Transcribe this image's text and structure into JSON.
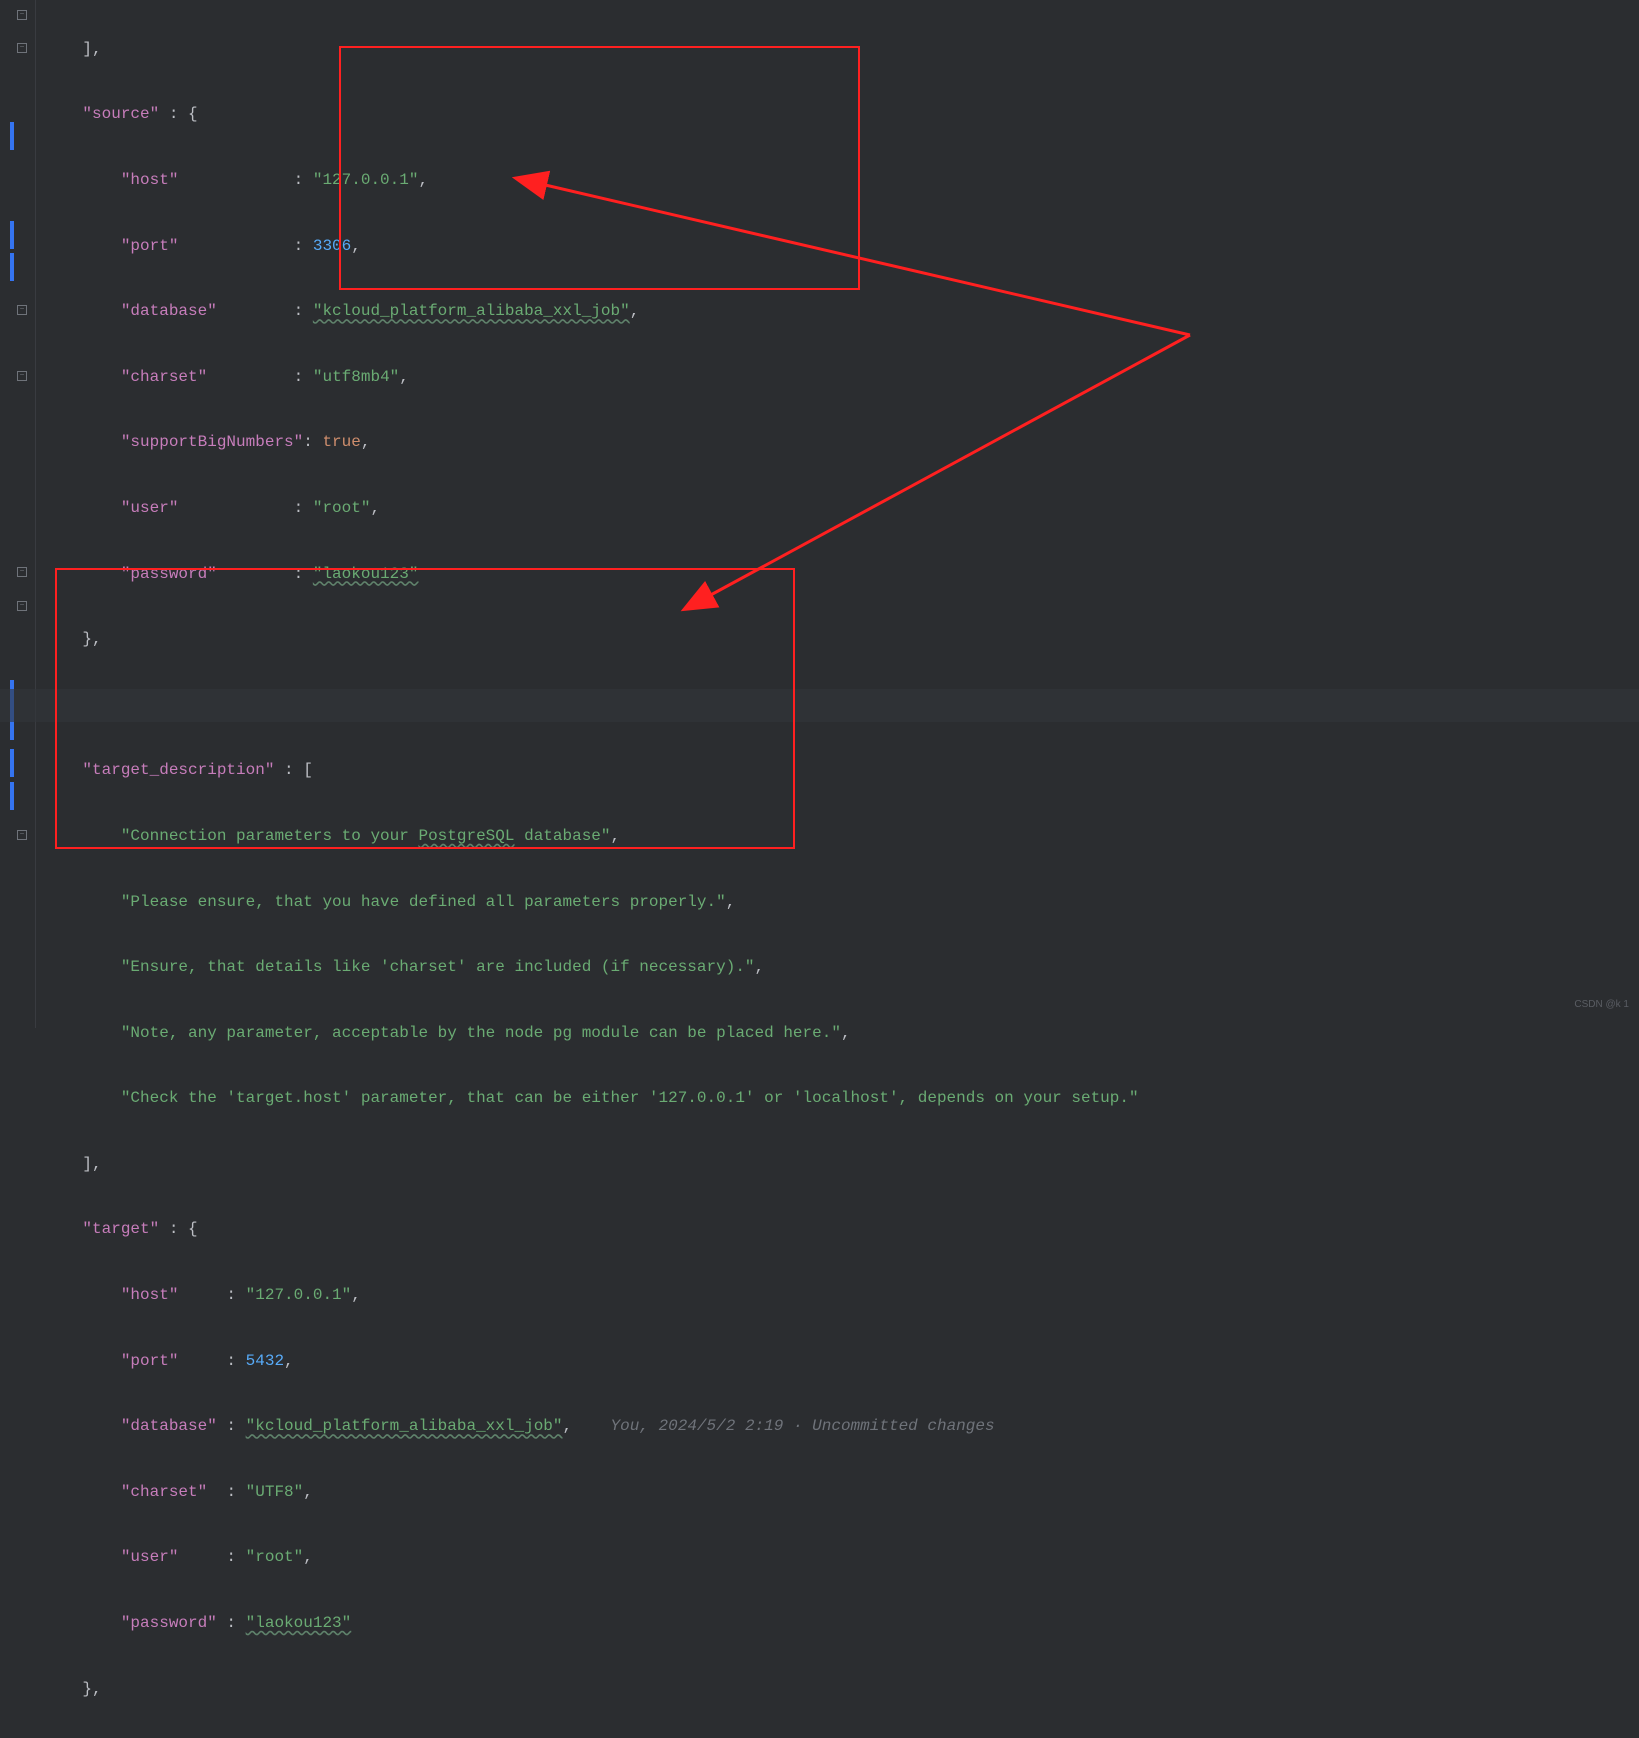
{
  "code": {
    "line0_trail": "],",
    "source_key": "\"source\"",
    "source_open": " : {",
    "source": {
      "host": {
        "k": "\"host\"",
        "sep": "            : ",
        "v": "\"127.0.0.1\"",
        "c": ","
      },
      "port": {
        "k": "\"port\"",
        "sep": "            : ",
        "v": "3306",
        "c": ","
      },
      "database": {
        "k": "\"database\"",
        "sep": "        : ",
        "v": "\"kcloud_platform_alibaba_xxl_job\"",
        "c": ","
      },
      "charset": {
        "k": "\"charset\"",
        "sep": "         : ",
        "v": "\"utf8mb4\"",
        "c": ","
      },
      "supportBigNumbers": {
        "k": "\"supportBigNumbers\"",
        "sep": ": ",
        "v": "true",
        "c": ","
      },
      "user": {
        "k": "\"user\"",
        "sep": "            : ",
        "v": "\"root\"",
        "c": ","
      },
      "password": {
        "k": "\"password\"",
        "sep": "        : ",
        "v": "\"laokou123\"",
        "c": ""
      }
    },
    "source_close": "},",
    "td_key": "\"target_description\"",
    "td_open": " : [",
    "td": [
      "\"Connection parameters to your PostgreSQL database\"",
      "\"Please ensure, that you have defined all parameters properly.\"",
      "\"Ensure, that details like 'charset' are included (if necessary).\"",
      "\"Note, any parameter, acceptable by the node pg module can be placed here.\"",
      "\"Check the 'target.host' parameter, that can be either '127.0.0.1' or 'localhost', depends on your setup.\""
    ],
    "td_close": "],",
    "target_key": "\"target\"",
    "target_open": " : {",
    "target": {
      "host": {
        "k": "\"host\"",
        "sep": "     : ",
        "v": "\"127.0.0.1\"",
        "c": ","
      },
      "port": {
        "k": "\"port\"",
        "sep": "     : ",
        "v": "5432",
        "c": ","
      },
      "database": {
        "k": "\"database\"",
        "sep": " : ",
        "v": "\"kcloud_platform_alibaba_xxl_job\"",
        "c": ","
      },
      "charset": {
        "k": "\"charset\"",
        "sep": "  : ",
        "v": "\"UTF8\"",
        "c": ","
      },
      "user": {
        "k": "\"user\"",
        "sep": "     : ",
        "v": "\"root\"",
        "c": ","
      },
      "password": {
        "k": "\"password\"",
        "sep": " : ",
        "v": "\"laokou123\"",
        "c": ""
      }
    },
    "target_close": "},"
  },
  "blame": "You, 2024/5/2 2:19 · Uncommitted changes",
  "watermark": "CSDN @k 1"
}
